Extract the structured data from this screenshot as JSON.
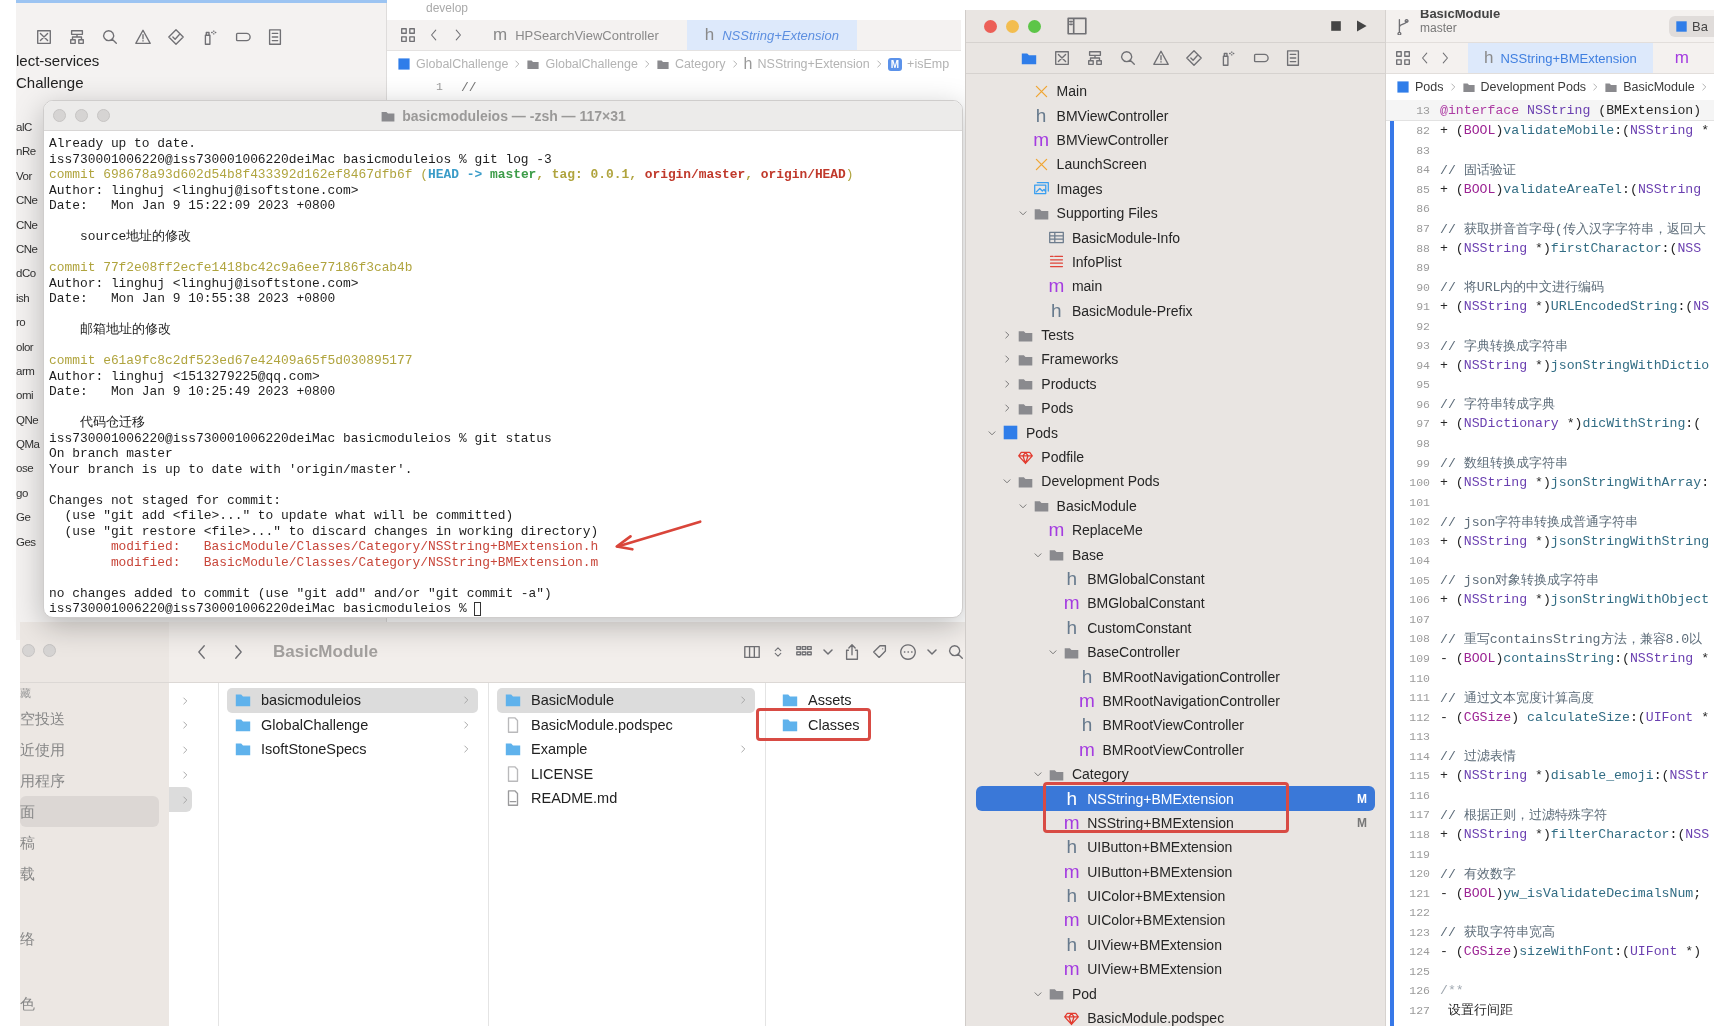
{
  "background_window": {
    "branch": "develop",
    "sidebar_items": [
      "lect-services",
      "Challenge"
    ],
    "sidebar_fragments": [
      "alC",
      "nRe",
      "Vor",
      "CNe",
      "CNe",
      "CNe",
      "dCo",
      "ish",
      "ro",
      "olor",
      "arm",
      "omi",
      "QNe",
      "QMa",
      "ose",
      "go",
      "Ge",
      "Ges"
    ],
    "tabs": [
      {
        "glyph": "m",
        "label": "HPSearchViewController",
        "selected": false
      },
      {
        "glyph": "h",
        "label": "NSString+Extension",
        "selected": true
      }
    ],
    "breadcrumb": [
      {
        "kind": "project",
        "label": "GlobalChallenge"
      },
      {
        "kind": "folder",
        "label": "GlobalChallenge"
      },
      {
        "kind": "folder",
        "label": "Category"
      },
      {
        "kind": "glyph",
        "glyph": "h",
        "label": "NSString+Extension"
      },
      {
        "kind": "badge",
        "glyph": "M",
        "label": "+isEmp"
      }
    ],
    "line_number": "1",
    "line_text": "//"
  },
  "terminal": {
    "title": "basicmoduleios — -zsh — 117×31",
    "blocks": [
      {
        "lines": [
          {
            "text": "Already up to date."
          },
          {
            "text": "iss730001006220@iss730001006220deiMac basicmoduleios % git log -3"
          },
          {
            "segments": [
              {
                "text": "commit 698678a93d602d54b8f433392d162ef8467dfb6f (",
                "color": "#b0a43e",
                "bold": false
              },
              {
                "text": "HEAD -> ",
                "color": "#3a9cc8",
                "bold": true
              },
              {
                "text": "master",
                "color": "#3c9c48",
                "bold": true
              },
              {
                "text": ", tag: 0.0.1, ",
                "color": "#b0a43e",
                "bold": true
              },
              {
                "text": "origin/master",
                "color": "#c0392b",
                "bold": true
              },
              {
                "text": ", ",
                "color": "#b0a43e",
                "bold": true
              },
              {
                "text": "origin/HEAD",
                "color": "#c0392b",
                "bold": true
              },
              {
                "text": ")",
                "color": "#b0a43e",
                "bold": false
              }
            ]
          },
          {
            "text": "Author: linghuj <linghuj@isoftstone.com>"
          },
          {
            "text": "Date:   Mon Jan 9 15:22:09 2023 +0800"
          }
        ]
      },
      {
        "lines": [
          {
            "text": "    source地址的修改"
          }
        ]
      },
      {
        "lines": [
          {
            "segments": [
              {
                "text": "commit 77f2e08ff2ecfe1418bc42c9a6ee77186f3cab4b",
                "color": "#b0a43e",
                "bold": false
              }
            ]
          },
          {
            "text": "Author: linghuj <linghuj@isoftstone.com>"
          },
          {
            "text": "Date:   Mon Jan 9 10:55:38 2023 +0800"
          }
        ]
      },
      {
        "lines": [
          {
            "text": "    邮箱地址的修改"
          }
        ]
      },
      {
        "lines": [
          {
            "segments": [
              {
                "text": "commit e61a9fc8c2df523ed67e42409a65f5d030895177",
                "color": "#b0a43e",
                "bold": false
              }
            ]
          },
          {
            "text": "Author: linghuj <1513279225@qq.com>"
          },
          {
            "text": "Date:   Mon Jan 9 10:25:49 2023 +0800"
          }
        ]
      },
      {
        "lines": [
          {
            "text": "    代码仓迁移"
          },
          {
            "text": "iss730001006220@iss730001006220deiMac basicmoduleios % git status"
          },
          {
            "text": "On branch master"
          },
          {
            "text": "Your branch is up to date with 'origin/master'."
          }
        ]
      },
      {
        "lines": [
          {
            "text": "Changes not staged for commit:"
          },
          {
            "text": "  (use \"git add <file>...\" to update what will be committed)"
          },
          {
            "text": "  (use \"git restore <file>...\" to discard changes in working directory)"
          },
          {
            "segments": [
              {
                "text": "        modified:   BasicModule/Classes/Category/NSString+BMExtension.h",
                "color": "#c8463a",
                "bold": false
              }
            ]
          },
          {
            "segments": [
              {
                "text": "        modified:   BasicModule/Classes/Category/NSString+BMExtension.m",
                "color": "#c8463a",
                "bold": false
              }
            ]
          }
        ]
      },
      {
        "lines": [
          {
            "text": "no changes added to commit (use \"git add\" and/or \"git commit -a\")"
          },
          {
            "text": "iss730001006220@iss730001006220deiMac basicmoduleios % ",
            "cursor": true
          }
        ]
      }
    ]
  },
  "finder": {
    "title": "BasicModule",
    "sidebar": [
      {
        "heading": "藏",
        "items": [
          {
            "label": "空投送",
            "selected": false
          },
          {
            "label": "近使用",
            "selected": false
          },
          {
            "label": "用程序",
            "selected": false
          },
          {
            "label": "面",
            "selected": true
          },
          {
            "label": "稿",
            "selected": false
          },
          {
            "label": "载",
            "selected": false
          }
        ]
      },
      {
        "items": [
          {
            "label": "络",
            "selected": false
          }
        ]
      },
      {
        "items": [
          {
            "label": "色",
            "selected": false
          }
        ]
      }
    ],
    "chevron_column": [
      {
        "selected": false
      },
      {
        "selected": false
      },
      {
        "selected": false
      },
      {
        "selected": false
      },
      {
        "selected": true
      }
    ],
    "columns": [
      [
        {
          "label": "basicmoduleios",
          "kind": "folder",
          "expandable": true,
          "selected": true
        },
        {
          "label": "GlobalChallenge",
          "kind": "folder",
          "expandable": true,
          "selected": false
        },
        {
          "label": "IsoftStoneSpecs",
          "kind": "folder",
          "expandable": true,
          "selected": false
        }
      ],
      [
        {
          "label": "BasicModule",
          "kind": "folder",
          "expandable": true,
          "selected": true
        },
        {
          "label": "BasicModule.podspec",
          "kind": "document",
          "expandable": false,
          "selected": false
        },
        {
          "label": "Example",
          "kind": "folder",
          "expandable": true,
          "selected": false
        },
        {
          "label": "LICENSE",
          "kind": "document",
          "expandable": false,
          "selected": false
        },
        {
          "label": "README.md",
          "kind": "markdown",
          "expandable": false,
          "selected": false
        }
      ],
      [
        {
          "label": "Assets",
          "kind": "folder",
          "expandable": false,
          "selected": false
        },
        {
          "label": "Classes",
          "kind": "folder",
          "expandable": false,
          "selected": false
        }
      ]
    ]
  },
  "navigator": {
    "tree": [
      {
        "children": [
          {
            "children": [
              {
                "label": "Main",
                "kind": "storyboard",
                "selected": false
              },
              {
                "label": "BMViewController",
                "kind": "glyph-h",
                "glyph": "h",
                "selected": false
              },
              {
                "label": "BMViewController",
                "kind": "glyph-m",
                "glyph": "m",
                "selected": false
              },
              {
                "label": "LaunchScreen",
                "kind": "storyboard",
                "selected": false
              },
              {
                "label": "Images",
                "kind": "assets",
                "selected": false
              },
              {
                "label": "Supporting Files",
                "kind": "folder",
                "expanded": true,
                "selected": false,
                "children": [
                  {
                    "label": "BasicModule-Info",
                    "kind": "plist",
                    "selected": false
                  },
                  {
                    "label": "InfoPlist",
                    "kind": "strings",
                    "selected": false
                  },
                  {
                    "label": "main",
                    "kind": "glyph-m",
                    "glyph": "m",
                    "selected": false
                  },
                  {
                    "label": "BasicModule-Prefix",
                    "kind": "glyph-h",
                    "glyph": "h",
                    "selected": false
                  }
                ]
              }
            ]
          },
          {
            "label": "Tests",
            "kind": "folder",
            "expanded": false,
            "selected": false
          },
          {
            "label": "Frameworks",
            "kind": "folder",
            "expanded": false,
            "selected": false
          },
          {
            "label": "Products",
            "kind": "folder",
            "expanded": false,
            "selected": false
          },
          {
            "label": "Pods",
            "kind": "folder",
            "expanded": false,
            "selected": false
          }
        ]
      },
      {
        "label": "Pods",
        "kind": "project",
        "expanded": true,
        "selected": false,
        "children": [
          {
            "label": "Podfile",
            "kind": "gem",
            "selected": false
          },
          {
            "label": "Development Pods",
            "kind": "folder",
            "expanded": true,
            "selected": false,
            "children": [
              {
                "label": "BasicModule",
                "kind": "folder",
                "expanded": true,
                "selected": false,
                "children": [
                  {
                    "label": "ReplaceMe",
                    "kind": "glyph-m",
                    "glyph": "m",
                    "selected": false
                  },
                  {
                    "label": "Base",
                    "kind": "folder",
                    "expanded": true,
                    "selected": false,
                    "children": [
                      {
                        "label": "BMGlobalConstant",
                        "kind": "glyph-h",
                        "glyph": "h",
                        "selected": false
                      },
                      {
                        "label": "BMGlobalConstant",
                        "kind": "glyph-m",
                        "glyph": "m",
                        "selected": false
                      },
                      {
                        "label": "CustomConstant",
                        "kind": "glyph-h",
                        "glyph": "h",
                        "selected": false
                      },
                      {
                        "label": "BaseController",
                        "kind": "folder",
                        "expanded": true,
                        "selected": false,
                        "children": [
                          {
                            "label": "BMRootNavigationController",
                            "kind": "glyph-h",
                            "glyph": "h",
                            "selected": false
                          },
                          {
                            "label": "BMRootNavigationController",
                            "kind": "glyph-m",
                            "glyph": "m",
                            "selected": false
                          },
                          {
                            "label": "BMRootViewController",
                            "kind": "glyph-h",
                            "glyph": "h",
                            "selected": false
                          },
                          {
                            "label": "BMRootViewController",
                            "kind": "glyph-m",
                            "glyph": "m",
                            "selected": false
                          }
                        ]
                      }
                    ]
                  },
                  {
                    "label": "Category",
                    "kind": "folder",
                    "expanded": true,
                    "selected": false,
                    "children": [
                      {
                        "label": "NSString+BMExtension",
                        "kind": "glyph-h",
                        "glyph": "h",
                        "badge": "M",
                        "selected": true
                      },
                      {
                        "label": "NSString+BMExtension",
                        "kind": "glyph-m",
                        "glyph": "m",
                        "badge": "M",
                        "selected": false
                      },
                      {
                        "label": "UIButton+BMExtension",
                        "kind": "glyph-h",
                        "glyph": "h",
                        "selected": false
                      },
                      {
                        "label": "UIButton+BMExtension",
                        "kind": "glyph-m",
                        "glyph": "m",
                        "selected": false
                      },
                      {
                        "label": "UIColor+BMExtension",
                        "kind": "glyph-h",
                        "glyph": "h",
                        "selected": false
                      },
                      {
                        "label": "UIColor+BMExtension",
                        "kind": "glyph-m",
                        "glyph": "m",
                        "selected": false
                      },
                      {
                        "label": "UIView+BMExtension",
                        "kind": "glyph-h",
                        "glyph": "h",
                        "selected": false
                      },
                      {
                        "label": "UIView+BMExtension",
                        "kind": "glyph-m",
                        "glyph": "m",
                        "selected": false
                      }
                    ]
                  },
                  {
                    "label": "Pod",
                    "kind": "folder",
                    "expanded": true,
                    "selected": false,
                    "children": [
                      {
                        "label": "BasicModule.podspec",
                        "kind": "gem",
                        "selected": false
                      }
                    ]
                  }
                ]
              }
            ]
          }
        ]
      }
    ]
  },
  "editor": {
    "scheme": "BasicModule",
    "branch": "master",
    "scheme_fragment": "Ba",
    "tabs": [
      {
        "glyph": "h",
        "label": "NSString+BMExtension",
        "selected": true
      },
      {
        "glyph": "m",
        "selected": false
      }
    ],
    "breadcrumb": [
      {
        "kind": "project",
        "label": "Pods"
      },
      {
        "kind": "folder",
        "label": "Development Pods"
      },
      {
        "kind": "folder",
        "label": "BasicModule"
      }
    ],
    "sticky": {
      "n": "13",
      "segments": [
        {
          "text": "@interface",
          "kind": "keyword"
        },
        {
          "text": " NSString ",
          "kind": "type"
        },
        {
          "text": "(BMExtension)",
          "kind": "plain"
        }
      ]
    },
    "lines": [
      {
        "n": "82",
        "segments": [
          {
            "text": "+ (",
            "kind": "plain"
          },
          {
            "text": "BOOL",
            "kind": "builtin"
          },
          {
            "text": ")",
            "kind": "plain"
          },
          {
            "text": "validateMobile",
            "kind": "method"
          },
          {
            "text": ":(",
            "kind": "plain"
          },
          {
            "text": "NSString",
            "kind": "type"
          },
          {
            "text": " *",
            "kind": "plain"
          }
        ]
      },
      {
        "n": "83"
      },
      {
        "n": "84",
        "segments": [
          {
            "text": "// 固话验证",
            "kind": "comment"
          }
        ]
      },
      {
        "n": "85",
        "segments": [
          {
            "text": "+ (",
            "kind": "plain"
          },
          {
            "text": "BOOL",
            "kind": "builtin"
          },
          {
            "text": ")",
            "kind": "plain"
          },
          {
            "text": "validateAreaTel",
            "kind": "method"
          },
          {
            "text": ":(",
            "kind": "plain"
          },
          {
            "text": "NSString",
            "kind": "type"
          }
        ]
      },
      {
        "n": "86"
      },
      {
        "n": "87",
        "segments": [
          {
            "text": "// 获取拼音首字母(传入汉字字符串，返回大",
            "kind": "comment"
          }
        ]
      },
      {
        "n": "88",
        "segments": [
          {
            "text": "+ (",
            "kind": "plain"
          },
          {
            "text": "NSString",
            "kind": "type"
          },
          {
            "text": " *)",
            "kind": "plain"
          },
          {
            "text": "firstCharactor",
            "kind": "method"
          },
          {
            "text": ":(",
            "kind": "plain"
          },
          {
            "text": "NSS",
            "kind": "type"
          }
        ]
      },
      {
        "n": "89"
      },
      {
        "n": "90",
        "segments": [
          {
            "text": "// 将URL内的中文进行编码",
            "kind": "comment"
          }
        ]
      },
      {
        "n": "91",
        "segments": [
          {
            "text": "+ (",
            "kind": "plain"
          },
          {
            "text": "NSString",
            "kind": "type"
          },
          {
            "text": " *)",
            "kind": "plain"
          },
          {
            "text": "URLEncodedString",
            "kind": "method"
          },
          {
            "text": ":(",
            "kind": "plain"
          },
          {
            "text": "NS",
            "kind": "type"
          }
        ]
      },
      {
        "n": "92"
      },
      {
        "n": "93",
        "segments": [
          {
            "text": "// 字典转换成字符串",
            "kind": "comment"
          }
        ]
      },
      {
        "n": "94",
        "segments": [
          {
            "text": "+ (",
            "kind": "plain"
          },
          {
            "text": "NSString",
            "kind": "type"
          },
          {
            "text": " *)",
            "kind": "plain"
          },
          {
            "text": "jsonStringWithDictio",
            "kind": "method"
          }
        ]
      },
      {
        "n": "95"
      },
      {
        "n": "96",
        "segments": [
          {
            "text": "// 字符串转成字典",
            "kind": "comment"
          }
        ]
      },
      {
        "n": "97",
        "segments": [
          {
            "text": "+ (",
            "kind": "plain"
          },
          {
            "text": "NSDictionary",
            "kind": "type"
          },
          {
            "text": " *)",
            "kind": "plain"
          },
          {
            "text": "dicWithString",
            "kind": "method"
          },
          {
            "text": ":(",
            "kind": "plain"
          }
        ]
      },
      {
        "n": "98"
      },
      {
        "n": "99",
        "segments": [
          {
            "text": "// 数组转换成字符串",
            "kind": "comment"
          }
        ]
      },
      {
        "n": "100",
        "segments": [
          {
            "text": "+ (",
            "kind": "plain"
          },
          {
            "text": "NSString",
            "kind": "type"
          },
          {
            "text": " *)",
            "kind": "plain"
          },
          {
            "text": "jsonStringWithArray",
            "kind": "method"
          },
          {
            "text": ":",
            "kind": "plain"
          }
        ]
      },
      {
        "n": "101"
      },
      {
        "n": "102",
        "segments": [
          {
            "text": "// json字符串转换成普通字符串",
            "kind": "comment"
          }
        ]
      },
      {
        "n": "103",
        "segments": [
          {
            "text": "+ (",
            "kind": "plain"
          },
          {
            "text": "NSString",
            "kind": "type"
          },
          {
            "text": " *)",
            "kind": "plain"
          },
          {
            "text": "jsonStringWithString",
            "kind": "method"
          }
        ]
      },
      {
        "n": "104"
      },
      {
        "n": "105",
        "segments": [
          {
            "text": "// json对象转换成字符串",
            "kind": "comment"
          }
        ]
      },
      {
        "n": "106",
        "segments": [
          {
            "text": "+ (",
            "kind": "plain"
          },
          {
            "text": "NSString",
            "kind": "type"
          },
          {
            "text": " *)",
            "kind": "plain"
          },
          {
            "text": "jsonStringWithObject",
            "kind": "method"
          }
        ]
      },
      {
        "n": "107"
      },
      {
        "n": "108",
        "segments": [
          {
            "text": "// 重写containsString方法，兼容8.0以",
            "kind": "comment"
          }
        ]
      },
      {
        "n": "109",
        "segments": [
          {
            "text": "- (",
            "kind": "plain"
          },
          {
            "text": "BOOL",
            "kind": "builtin"
          },
          {
            "text": ")",
            "kind": "plain"
          },
          {
            "text": "containsString",
            "kind": "method"
          },
          {
            "text": ":(",
            "kind": "plain"
          },
          {
            "text": "NSString",
            "kind": "type"
          },
          {
            "text": " *",
            "kind": "plain"
          }
        ]
      },
      {
        "n": "110"
      },
      {
        "n": "111",
        "segments": [
          {
            "text": "// 通过文本宽度计算高度",
            "kind": "comment"
          }
        ]
      },
      {
        "n": "112",
        "segments": [
          {
            "text": "- (",
            "kind": "plain"
          },
          {
            "text": "CGSize",
            "kind": "builtin"
          },
          {
            "text": ") ",
            "kind": "plain"
          },
          {
            "text": "calculateSize",
            "kind": "method"
          },
          {
            "text": ":(",
            "kind": "plain"
          },
          {
            "text": "UIFont",
            "kind": "type"
          },
          {
            "text": " *",
            "kind": "plain"
          }
        ]
      },
      {
        "n": "113"
      },
      {
        "n": "114",
        "segments": [
          {
            "text": "// 过滤表情",
            "kind": "comment"
          }
        ]
      },
      {
        "n": "115",
        "segments": [
          {
            "text": "+ (",
            "kind": "plain"
          },
          {
            "text": "NSString",
            "kind": "type"
          },
          {
            "text": " *)",
            "kind": "plain"
          },
          {
            "text": "disable_emoji",
            "kind": "method"
          },
          {
            "text": ":(",
            "kind": "plain"
          },
          {
            "text": "NSStr",
            "kind": "type"
          }
        ]
      },
      {
        "n": "116"
      },
      {
        "n": "117",
        "segments": [
          {
            "text": "// 根据正则，过滤特殊字符",
            "kind": "comment"
          }
        ]
      },
      {
        "n": "118",
        "segments": [
          {
            "text": "+ (",
            "kind": "plain"
          },
          {
            "text": "NSString",
            "kind": "type"
          },
          {
            "text": " *)",
            "kind": "plain"
          },
          {
            "text": "filterCharactor",
            "kind": "method"
          },
          {
            "text": ":(",
            "kind": "plain"
          },
          {
            "text": "NSS",
            "kind": "type"
          }
        ]
      },
      {
        "n": "119"
      },
      {
        "n": "120",
        "segments": [
          {
            "text": "// 有效数字",
            "kind": "comment"
          }
        ]
      },
      {
        "n": "121",
        "segments": [
          {
            "text": "- (",
            "kind": "plain"
          },
          {
            "text": "BOOL",
            "kind": "builtin"
          },
          {
            "text": ")",
            "kind": "plain"
          },
          {
            "text": "yw_isValidateDecimalsNum",
            "kind": "method"
          },
          {
            "text": ";",
            "kind": "plain"
          }
        ]
      },
      {
        "n": "122"
      },
      {
        "n": "123",
        "segments": [
          {
            "text": "// 获取字符串宽高",
            "kind": "comment"
          }
        ]
      },
      {
        "n": "124",
        "segments": [
          {
            "text": "- (",
            "kind": "plain"
          },
          {
            "text": "CGSize",
            "kind": "builtin"
          },
          {
            "text": ")",
            "kind": "plain"
          },
          {
            "text": "sizeWithFont",
            "kind": "method"
          },
          {
            "text": ":(",
            "kind": "plain"
          },
          {
            "text": "UIFont",
            "kind": "type"
          },
          {
            "text": " *)",
            "kind": "plain"
          }
        ]
      },
      {
        "n": "125"
      },
      {
        "n": "126",
        "segments": [
          {
            "text": "/**",
            "kind": "doc"
          }
        ]
      },
      {
        "n": "127",
        "segments": [
          {
            "text": " 设置行间距",
            "kind": "plain"
          }
        ]
      }
    ]
  }
}
